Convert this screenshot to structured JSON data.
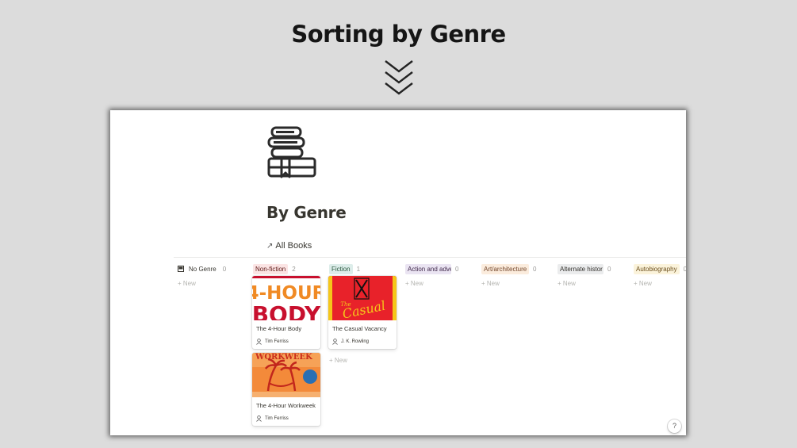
{
  "heading": "Sorting by Genre",
  "page": {
    "title": "By Genre",
    "view_link": "All Books"
  },
  "columns": [
    {
      "label": "No Genre",
      "count": "0",
      "new_label": "New",
      "tag_bg": "transparent",
      "tag_color": "#37352f"
    },
    {
      "label": "Non-fiction",
      "count": "2",
      "new_label": "",
      "tag_bg": "#fbe4e4",
      "tag_color": "#5d1715"
    },
    {
      "label": "Fiction",
      "count": "1",
      "new_label": "New",
      "tag_bg": "#ddedea",
      "tag_color": "#2b593f"
    },
    {
      "label": "Action and adve",
      "count": "0",
      "new_label": "New",
      "tag_bg": "#eae4f2",
      "tag_color": "#412a4c"
    },
    {
      "label": "Art/architecture",
      "count": "0",
      "new_label": "New",
      "tag_bg": "#fbecdd",
      "tag_color": "#73462b"
    },
    {
      "label": "Alternate histor",
      "count": "0",
      "new_label": "New",
      "tag_bg": "#ebeced",
      "tag_color": "#32302c"
    },
    {
      "label": "Autobiography",
      "count": "0",
      "new_label": "New",
      "tag_bg": "#fbf3db",
      "tag_color": "#6b4e1c"
    }
  ],
  "cards": [
    {
      "title": "The 4-Hour Body",
      "author": "Tim Ferriss",
      "cover_text": "4-HOUR",
      "cover_text2": "BODY"
    },
    {
      "title": "The 4-Hour Workweek",
      "author": "Tim Ferriss",
      "cover_text": "WORKWEEK"
    },
    {
      "title": "The Casual Vacancy",
      "author": "J. K. Rowling",
      "cover_text": "Casual",
      "cover_text2": "The"
    }
  ],
  "icons": {
    "page": "book-stack-icon",
    "no_genre": "books-icon",
    "author": "person-icon",
    "help": "question-mark-icon",
    "heading": "double-chevron-down-icon"
  },
  "colors": {
    "background": "#dcdcdc",
    "text": "#37352f",
    "body_red": "#c8102e",
    "workweek_orange": "#f0883e",
    "casual_red": "#e8222a"
  },
  "help_label": "?"
}
